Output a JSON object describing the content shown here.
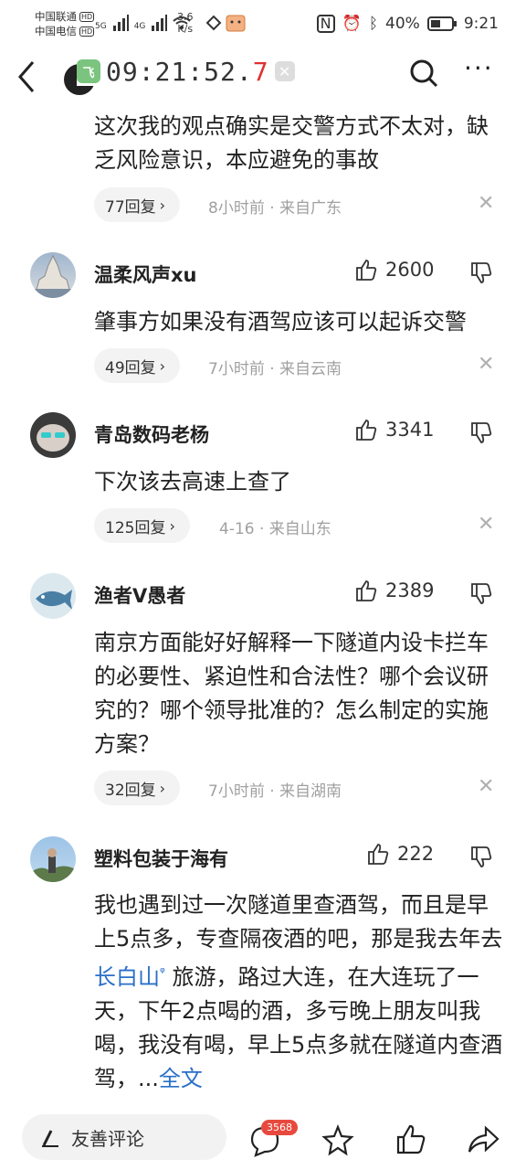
{
  "status_bar": {
    "carrier1": "中国联通",
    "carrier2": "中国电信",
    "hd": "HD",
    "sig1": "5G",
    "sig2": "4G",
    "net_speed_value": "3.6",
    "net_speed_unit": "K/s",
    "battery": "40%",
    "time": "9:21"
  },
  "nav": {
    "timer_prefix": "09:21:52.",
    "timer_suffix": "7",
    "timer_icon_label": "飞"
  },
  "comments": [
    {
      "text": "这次我的观点确实是交警方式不太对，缺乏风险意识，本应避免的事故",
      "replies": "77回复",
      "meta": "8小时前 · 来自广东"
    },
    {
      "user": "温柔风声xu",
      "likes": "2600",
      "text": "肇事方如果没有酒驾应该可以起诉交警",
      "replies": "49回复",
      "meta": "7小时前 · 来自云南"
    },
    {
      "user": "青岛数码老杨",
      "likes": "3341",
      "text": "下次该去高速上查了",
      "replies": "125回复",
      "meta": "4-16 · 来自山东"
    },
    {
      "user": "渔者V愚者",
      "likes": "2389",
      "text": "南京方面能好好解释一下隧道内设卡拦车的必要性、紧迫性和合法性？哪个会议研究的？哪个领导批准的？怎么制定的实施方案？",
      "replies": "32回复",
      "meta": "7小时前 · 来自湖南"
    },
    {
      "user": "塑料包装于海有",
      "likes": "222",
      "text_before": "我也遇到过一次隧道里查酒驾，而且是早上5点多，专查隔夜酒的吧，那是我去年去",
      "link_text": "长白山",
      "text_after": " 旅游，路过大连，在大连玩了一天，下午2点喝的酒，多亏晚上朋友叫我喝，我没有喝，早上5点多就在隧道内查酒驾，...",
      "full_text_link": "全文"
    }
  ],
  "bottom_bar": {
    "input_placeholder": "友善评论",
    "comment_count": "3568"
  },
  "colors": {
    "link": "#2a6fc9",
    "badge": "#e8493e",
    "timer_red": "#e03030",
    "meta_gray": "#a0a0a0"
  }
}
